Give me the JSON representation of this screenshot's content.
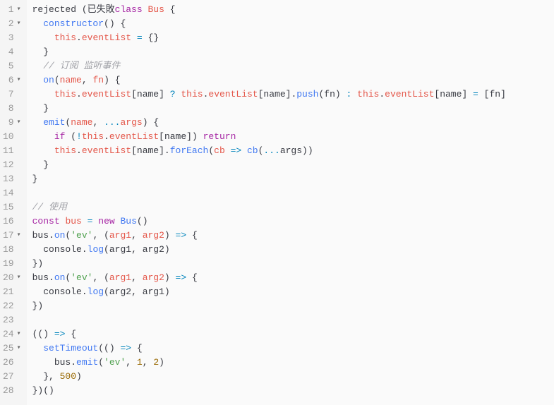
{
  "language": "javascript",
  "lines": [
    {
      "n": 1,
      "fold": true,
      "indent": 0,
      "tokens": [
        [
          "plain",
          "rejected "
        ],
        [
          "pun",
          "("
        ],
        [
          "plain",
          "已失敗"
        ],
        [
          "kw",
          "class"
        ],
        [
          "plain",
          " "
        ],
        [
          "id",
          "Bus"
        ],
        [
          "plain",
          " "
        ],
        [
          "pun",
          "{"
        ]
      ]
    },
    {
      "n": 2,
      "fold": true,
      "indent": 1,
      "tokens": [
        [
          "fn",
          "constructor"
        ],
        [
          "pun",
          "()"
        ],
        [
          "plain",
          " "
        ],
        [
          "pun",
          "{"
        ]
      ]
    },
    {
      "n": 3,
      "fold": false,
      "indent": 2,
      "tokens": [
        [
          "this",
          "this"
        ],
        [
          "pun",
          "."
        ],
        [
          "prop",
          "eventList"
        ],
        [
          "plain",
          " "
        ],
        [
          "op",
          "="
        ],
        [
          "plain",
          " "
        ],
        [
          "pun",
          "{}"
        ]
      ]
    },
    {
      "n": 4,
      "fold": false,
      "indent": 1,
      "tokens": [
        [
          "pun",
          "}"
        ]
      ]
    },
    {
      "n": 5,
      "fold": false,
      "indent": 1,
      "tokens": [
        [
          "cmt",
          "// 订阅 监听事件"
        ]
      ]
    },
    {
      "n": 6,
      "fold": true,
      "indent": 1,
      "tokens": [
        [
          "fn",
          "on"
        ],
        [
          "pun",
          "("
        ],
        [
          "id",
          "name"
        ],
        [
          "pun",
          ", "
        ],
        [
          "id",
          "fn"
        ],
        [
          "pun",
          ")"
        ],
        [
          "plain",
          " "
        ],
        [
          "pun",
          "{"
        ]
      ]
    },
    {
      "n": 7,
      "fold": false,
      "indent": 2,
      "tokens": [
        [
          "this",
          "this"
        ],
        [
          "pun",
          "."
        ],
        [
          "prop",
          "eventList"
        ],
        [
          "pun",
          "["
        ],
        [
          "plain",
          "name"
        ],
        [
          "pun",
          "]"
        ],
        [
          "plain",
          " "
        ],
        [
          "op",
          "?"
        ],
        [
          "plain",
          " "
        ],
        [
          "this",
          "this"
        ],
        [
          "pun",
          "."
        ],
        [
          "prop",
          "eventList"
        ],
        [
          "pun",
          "["
        ],
        [
          "plain",
          "name"
        ],
        [
          "pun",
          "]."
        ],
        [
          "fn",
          "push"
        ],
        [
          "pun",
          "("
        ],
        [
          "plain",
          "fn"
        ],
        [
          "pun",
          ")"
        ],
        [
          "plain",
          " "
        ],
        [
          "op",
          ":"
        ],
        [
          "plain",
          " "
        ],
        [
          "this",
          "this"
        ],
        [
          "pun",
          "."
        ],
        [
          "prop",
          "eventList"
        ],
        [
          "pun",
          "["
        ],
        [
          "plain",
          "name"
        ],
        [
          "pun",
          "]"
        ],
        [
          "plain",
          " "
        ],
        [
          "op",
          "="
        ],
        [
          "plain",
          " "
        ],
        [
          "pun",
          "["
        ],
        [
          "plain",
          "fn"
        ],
        [
          "pun",
          "]"
        ]
      ]
    },
    {
      "n": 8,
      "fold": false,
      "indent": 1,
      "tokens": [
        [
          "pun",
          "}"
        ]
      ]
    },
    {
      "n": 9,
      "fold": true,
      "indent": 1,
      "tokens": [
        [
          "fn",
          "emit"
        ],
        [
          "pun",
          "("
        ],
        [
          "id",
          "name"
        ],
        [
          "pun",
          ", "
        ],
        [
          "op",
          "..."
        ],
        [
          "id",
          "args"
        ],
        [
          "pun",
          ")"
        ],
        [
          "plain",
          " "
        ],
        [
          "pun",
          "{"
        ]
      ]
    },
    {
      "n": 10,
      "fold": false,
      "indent": 2,
      "tokens": [
        [
          "kw",
          "if"
        ],
        [
          "plain",
          " "
        ],
        [
          "pun",
          "("
        ],
        [
          "op",
          "!"
        ],
        [
          "this",
          "this"
        ],
        [
          "pun",
          "."
        ],
        [
          "prop",
          "eventList"
        ],
        [
          "pun",
          "["
        ],
        [
          "plain",
          "name"
        ],
        [
          "pun",
          "])"
        ],
        [
          "plain",
          " "
        ],
        [
          "kw",
          "return"
        ]
      ]
    },
    {
      "n": 11,
      "fold": false,
      "indent": 2,
      "tokens": [
        [
          "this",
          "this"
        ],
        [
          "pun",
          "."
        ],
        [
          "prop",
          "eventList"
        ],
        [
          "pun",
          "["
        ],
        [
          "plain",
          "name"
        ],
        [
          "pun",
          "]."
        ],
        [
          "fn",
          "forEach"
        ],
        [
          "pun",
          "("
        ],
        [
          "id",
          "cb"
        ],
        [
          "plain",
          " "
        ],
        [
          "op",
          "=>"
        ],
        [
          "plain",
          " "
        ],
        [
          "fn",
          "cb"
        ],
        [
          "pun",
          "("
        ],
        [
          "op",
          "..."
        ],
        [
          "plain",
          "args"
        ],
        [
          "pun",
          "))"
        ]
      ]
    },
    {
      "n": 12,
      "fold": false,
      "indent": 1,
      "tokens": [
        [
          "pun",
          "}"
        ]
      ]
    },
    {
      "n": 13,
      "fold": false,
      "indent": 0,
      "tokens": [
        [
          "pun",
          "}"
        ]
      ]
    },
    {
      "n": 14,
      "fold": false,
      "indent": 0,
      "tokens": []
    },
    {
      "n": 15,
      "fold": false,
      "indent": 0,
      "tokens": [
        [
          "cmt",
          "// 使用"
        ]
      ]
    },
    {
      "n": 16,
      "fold": false,
      "indent": 0,
      "tokens": [
        [
          "kw",
          "const"
        ],
        [
          "plain",
          " "
        ],
        [
          "id",
          "bus"
        ],
        [
          "plain",
          " "
        ],
        [
          "op",
          "="
        ],
        [
          "plain",
          " "
        ],
        [
          "kw",
          "new"
        ],
        [
          "plain",
          " "
        ],
        [
          "fn",
          "Bus"
        ],
        [
          "pun",
          "()"
        ]
      ]
    },
    {
      "n": 17,
      "fold": true,
      "indent": 0,
      "tokens": [
        [
          "plain",
          "bus"
        ],
        [
          "pun",
          "."
        ],
        [
          "fn",
          "on"
        ],
        [
          "pun",
          "("
        ],
        [
          "str",
          "'ev'"
        ],
        [
          "pun",
          ", ("
        ],
        [
          "id",
          "arg1"
        ],
        [
          "pun",
          ", "
        ],
        [
          "id",
          "arg2"
        ],
        [
          "pun",
          ")"
        ],
        [
          "plain",
          " "
        ],
        [
          "op",
          "=>"
        ],
        [
          "plain",
          " "
        ],
        [
          "pun",
          "{"
        ]
      ]
    },
    {
      "n": 18,
      "fold": false,
      "indent": 1,
      "tokens": [
        [
          "plain",
          "console"
        ],
        [
          "pun",
          "."
        ],
        [
          "fn",
          "log"
        ],
        [
          "pun",
          "("
        ],
        [
          "plain",
          "arg1"
        ],
        [
          "pun",
          ", "
        ],
        [
          "plain",
          "arg2"
        ],
        [
          "pun",
          ")"
        ]
      ]
    },
    {
      "n": 19,
      "fold": false,
      "indent": 0,
      "tokens": [
        [
          "pun",
          "})"
        ]
      ]
    },
    {
      "n": 20,
      "fold": true,
      "indent": 0,
      "tokens": [
        [
          "plain",
          "bus"
        ],
        [
          "pun",
          "."
        ],
        [
          "fn",
          "on"
        ],
        [
          "pun",
          "("
        ],
        [
          "str",
          "'ev'"
        ],
        [
          "pun",
          ", ("
        ],
        [
          "id",
          "arg1"
        ],
        [
          "pun",
          ", "
        ],
        [
          "id",
          "arg2"
        ],
        [
          "pun",
          ")"
        ],
        [
          "plain",
          " "
        ],
        [
          "op",
          "=>"
        ],
        [
          "plain",
          " "
        ],
        [
          "pun",
          "{"
        ]
      ]
    },
    {
      "n": 21,
      "fold": false,
      "indent": 1,
      "tokens": [
        [
          "plain",
          "console"
        ],
        [
          "pun",
          "."
        ],
        [
          "fn",
          "log"
        ],
        [
          "pun",
          "("
        ],
        [
          "plain",
          "arg2"
        ],
        [
          "pun",
          ", "
        ],
        [
          "plain",
          "arg1"
        ],
        [
          "pun",
          ")"
        ]
      ]
    },
    {
      "n": 22,
      "fold": false,
      "indent": 0,
      "tokens": [
        [
          "pun",
          "})"
        ]
      ]
    },
    {
      "n": 23,
      "fold": false,
      "indent": 0,
      "tokens": []
    },
    {
      "n": 24,
      "fold": true,
      "indent": 0,
      "tokens": [
        [
          "pun",
          "(()"
        ],
        [
          "plain",
          " "
        ],
        [
          "op",
          "=>"
        ],
        [
          "plain",
          " "
        ],
        [
          "pun",
          "{"
        ]
      ]
    },
    {
      "n": 25,
      "fold": true,
      "indent": 1,
      "tokens": [
        [
          "fn",
          "setTimeout"
        ],
        [
          "pun",
          "(()"
        ],
        [
          "plain",
          " "
        ],
        [
          "op",
          "=>"
        ],
        [
          "plain",
          " "
        ],
        [
          "pun",
          "{"
        ]
      ]
    },
    {
      "n": 26,
      "fold": false,
      "indent": 2,
      "tokens": [
        [
          "plain",
          "bus"
        ],
        [
          "pun",
          "."
        ],
        [
          "fn",
          "emit"
        ],
        [
          "pun",
          "("
        ],
        [
          "str",
          "'ev'"
        ],
        [
          "pun",
          ", "
        ],
        [
          "num",
          "1"
        ],
        [
          "pun",
          ", "
        ],
        [
          "num",
          "2"
        ],
        [
          "pun",
          ")"
        ]
      ]
    },
    {
      "n": 27,
      "fold": false,
      "indent": 1,
      "tokens": [
        [
          "pun",
          "}, "
        ],
        [
          "num",
          "500"
        ],
        [
          "pun",
          ")"
        ]
      ]
    },
    {
      "n": 28,
      "fold": false,
      "indent": 0,
      "tokens": [
        [
          "pun",
          "})()"
        ]
      ]
    }
  ],
  "indentUnit": "  "
}
